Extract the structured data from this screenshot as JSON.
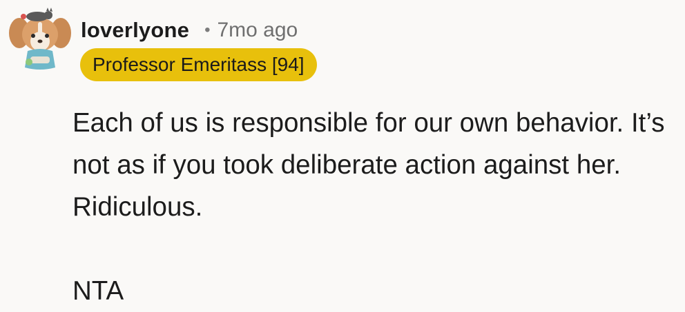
{
  "comment": {
    "username": "loverlyone",
    "separator": "•",
    "timestamp": "7mo ago",
    "flair": "Professor Emeritass [94]",
    "paragraphs": [
      "Each of us is responsible for our own behavior. It’s not as if you took deliberate action against her. Ridiculous.",
      "NTA"
    ],
    "avatar_icon": "dog-with-cat-avatar-icon"
  },
  "colors": {
    "background": "#faf9f7",
    "flair_background": "#e8c00c",
    "username": "#1c1c1c",
    "timestamp": "#6f6f6f"
  }
}
